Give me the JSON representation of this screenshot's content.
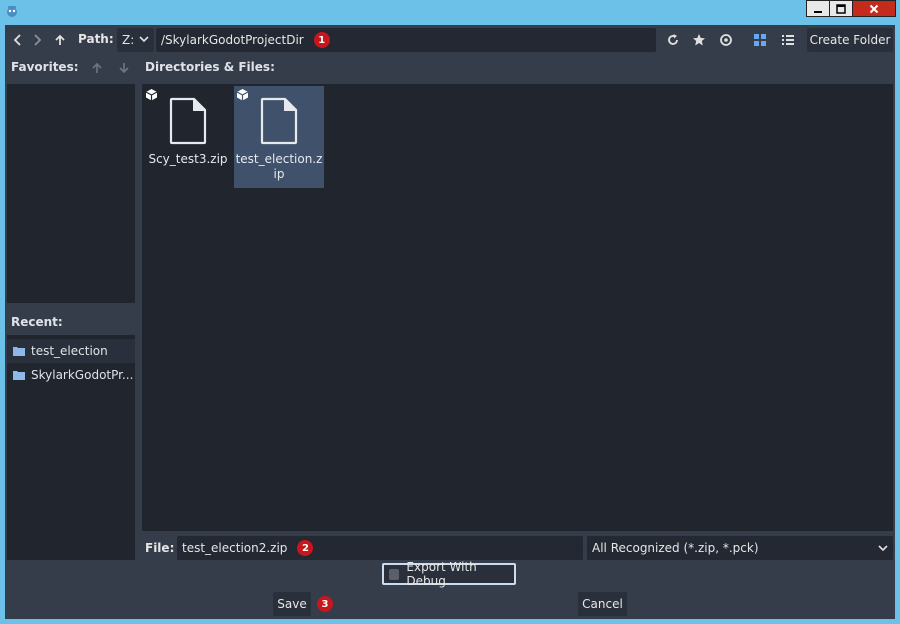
{
  "toolbar": {
    "path_label": "Path:",
    "drive": "Z:",
    "path_value": "/SkylarkGodotProjectDir",
    "path_badge": "1",
    "create_folder": "Create Folder"
  },
  "favorites": {
    "label": "Favorites:"
  },
  "recent": {
    "label": "Recent:",
    "items": [
      "test_election",
      "SkylarkGodotPr..."
    ]
  },
  "files": {
    "label": "Directories & Files:",
    "items": [
      {
        "name": "Scy_test3.zip",
        "selected": false
      },
      {
        "name": "test_election.zip",
        "selected": true
      }
    ]
  },
  "bottom": {
    "file_label": "File:",
    "file_value": "test_election2.zip",
    "file_badge": "2",
    "filter": "All Recognized (*.zip, *.pck)",
    "export_debug": "Export With Debug",
    "save": "Save",
    "save_badge": "3",
    "cancel": "Cancel"
  },
  "colors": {
    "titlebar": "#6cc1e8",
    "panel": "#363d4a",
    "field": "#232833",
    "selection": "#40526b",
    "badge": "#c8161d",
    "close": "#c42b1c"
  },
  "icons": [
    "app-icon",
    "back-icon",
    "forward-icon",
    "up-icon",
    "refresh-icon",
    "star-icon",
    "eye-icon",
    "grid-view-icon",
    "list-view-icon",
    "folder-icon",
    "file-icon",
    "package-icon",
    "chevron-down-icon",
    "minimize-icon",
    "maximize-icon",
    "close-icon"
  ]
}
